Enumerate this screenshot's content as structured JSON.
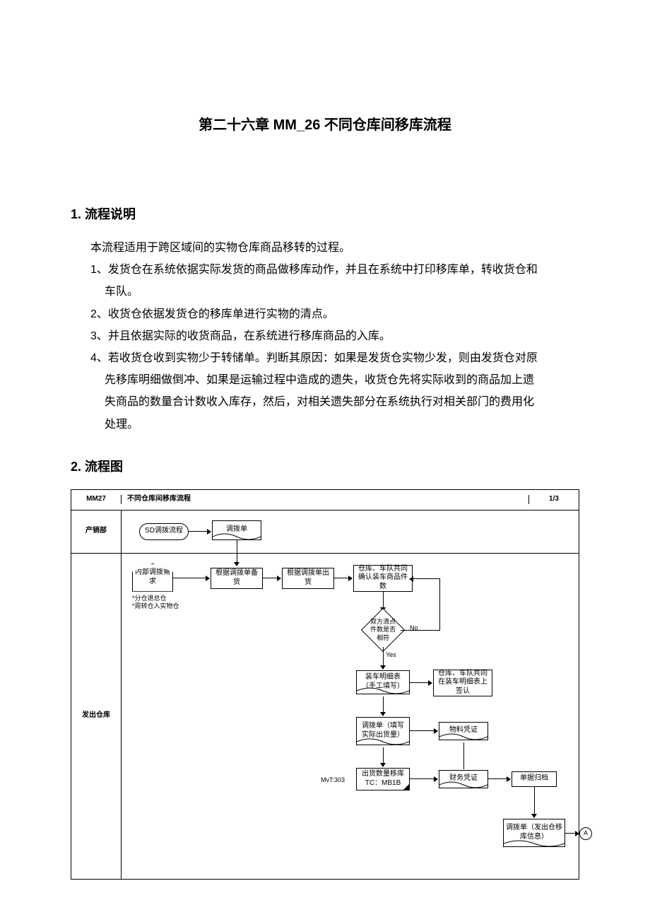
{
  "chapter_title": "第二十六章 MM_26 不同仓库间移库流程",
  "sec1": {
    "heading": "1.  流程说明",
    "intro": "本流程适用于跨区域间的实物仓库商品移转的过程。",
    "items": {
      "i1": "1、发货仓在系统依据实际发货的商品做移库动作，并且在系统中打印移库单，转收货仓和",
      "i1b": "车队。",
      "i2": "2、收货仓依据发货仓的移库单进行实物的清点。",
      "i3": "3、并且依据实际的收货商品，在系统进行移库商品的入库。",
      "i4": "4、若收货仓收到实物少于转储单。判断其原因：如果是发货仓实物少发，则由发货仓对原",
      "i4b1": "先移库明细做倒冲、如果是运输过程中造成的遗失，收货仓先将实际收到的商品加上遗",
      "i4b2": "失商品的数量合计数收入库存，然后，对相关遗失部分在系统执行对相关部门的费用化",
      "i4b3": "处理。"
    }
  },
  "sec2": {
    "heading": "2.  流程图"
  },
  "flow": {
    "header": {
      "code": "MM27",
      "title": "不同仓库间移库流程",
      "page": "1/3"
    },
    "lane1": {
      "label": "产销部",
      "nodes": {
        "sd": "SD调拨流程",
        "doc1": "调拨单"
      }
    },
    "lane2": {
      "label": "发出仓库",
      "nodes": {
        "home": "内部调拨需求",
        "home_note": "*分仓退总仓\n*周转仓入实物仓",
        "prep": "根据调拨单备货",
        "ship": "根据调拨单出货",
        "confirm_qty": "仓库、车队共同确认装车商品件数",
        "diamond": "双方清点件数是否相符",
        "d_no": "No",
        "d_yes": "Yes",
        "loadsheet": "装车明细表（手工填写）",
        "sign": "仓库、车队共同在装车明细表上签认",
        "fill": "调拨单（填写实际出货量）",
        "move": "出货数量移库 TC：MB1B",
        "move_note": "MvT:303",
        "matdoc": "物料凭证",
        "findoc": "财务凭证",
        "archive": "单据归档",
        "outdoc": "调拨单（发出仓移库信息）",
        "connA": "A"
      }
    }
  }
}
